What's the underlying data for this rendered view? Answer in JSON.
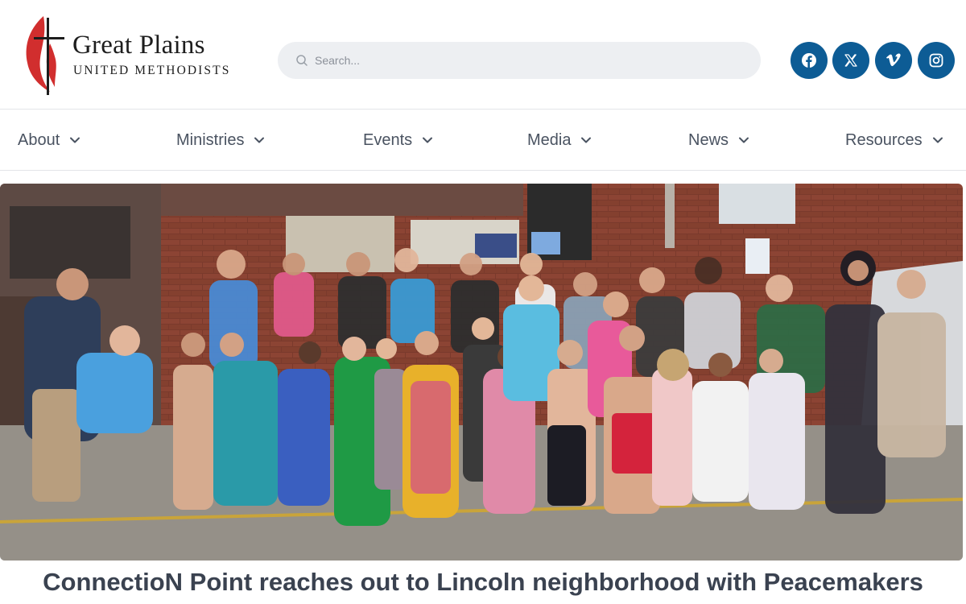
{
  "header": {
    "logo": {
      "line1": "Great Plains",
      "line2": "UNITED METHODISTS",
      "icon": "cross-and-flame-icon",
      "flame_color": "#d12e2e"
    },
    "search": {
      "placeholder": "Search...",
      "icon": "search-icon"
    },
    "social": [
      {
        "name": "facebook",
        "icon": "facebook-icon"
      },
      {
        "name": "x",
        "icon": "x-icon"
      },
      {
        "name": "vimeo",
        "icon": "vimeo-icon"
      },
      {
        "name": "instagram",
        "icon": "instagram-icon"
      }
    ],
    "social_color": "#0d5c95"
  },
  "nav": {
    "items": [
      {
        "label": "About"
      },
      {
        "label": "Ministries"
      },
      {
        "label": "Events"
      },
      {
        "label": "Media"
      },
      {
        "label": "News"
      },
      {
        "label": "Resources"
      }
    ]
  },
  "hero": {
    "image": "group-photo"
  },
  "article": {
    "headline": "ConnectioN Point reaches out to Lincoln neighborhood with Peacemakers"
  }
}
